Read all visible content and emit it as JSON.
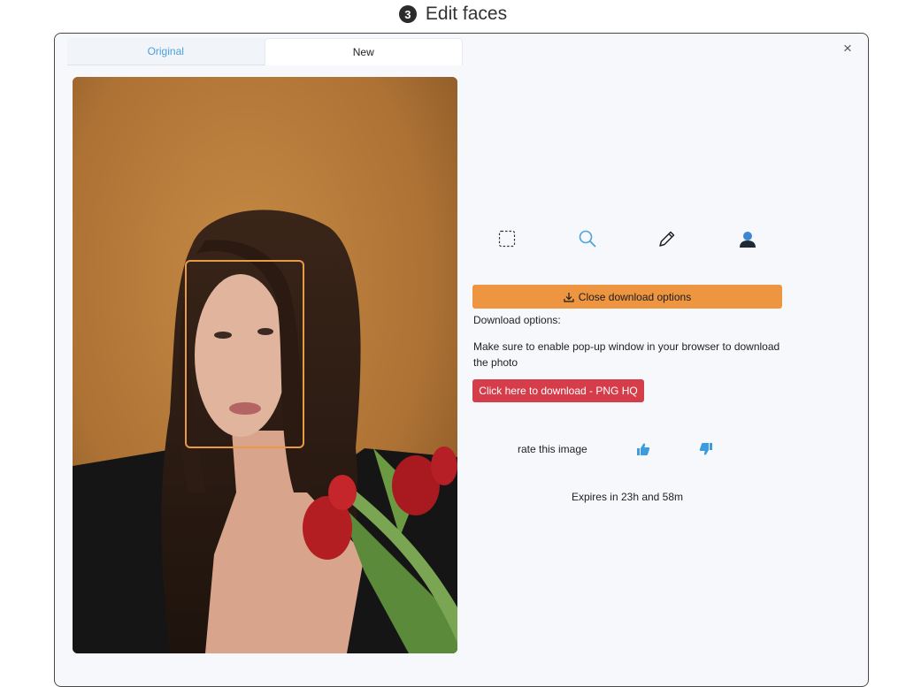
{
  "header": {
    "step_number": "3",
    "title": "Edit faces"
  },
  "modal": {
    "close_glyph": "×",
    "tabs": [
      {
        "label": "Original",
        "active": false
      },
      {
        "label": "New",
        "active": true
      }
    ],
    "tools": [
      {
        "icon": "select-rectangle-icon"
      },
      {
        "icon": "search-icon"
      },
      {
        "icon": "pencil-icon"
      },
      {
        "icon": "person-icon"
      }
    ],
    "close_download_label": "Close download options",
    "download_options_label": "Download options:",
    "popup_note": "Make sure to enable pop-up window in your browser to download the photo",
    "download_button_label": "Click here to download - PNG HQ",
    "rate_label": "rate this image",
    "expires_text": "Expires in 23h and 58m"
  },
  "colors": {
    "accent_orange": "#ed9540",
    "download_red": "#d63d4a",
    "tab_active_blue": "#4ba3dc",
    "face_box": "#e89a45"
  }
}
